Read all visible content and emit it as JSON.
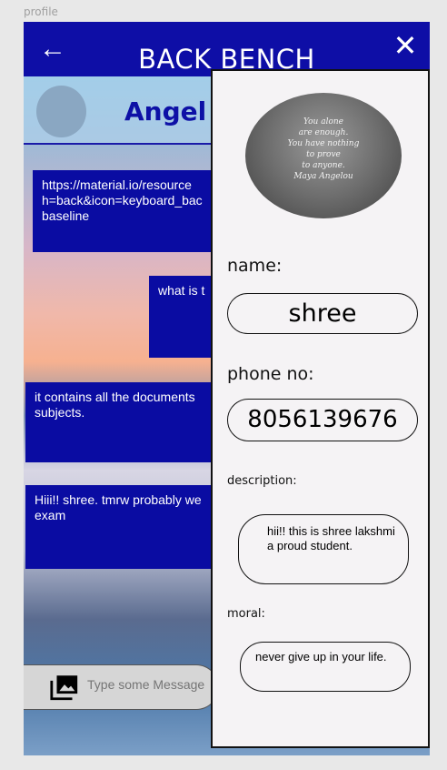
{
  "frame": {
    "label": "profile"
  },
  "appbar": {
    "title": "BACK BENCH",
    "back_icon": "arrow-left-icon",
    "close_icon": "close-icon",
    "back_glyph": "←",
    "close_glyph": "✕",
    "color": "#0e0ea6"
  },
  "chat": {
    "name": "Angel",
    "messages": [
      {
        "text": "https://material.io/resource\nh=back&icon=keyboard_bac\nbaseline"
      },
      {
        "text": "what is t"
      },
      {
        "text": "it contains all the documents\nsubjects."
      },
      {
        "text": "Hiii!! shree. tmrw probably we\nexam"
      }
    ],
    "input_placeholder": "Type some Message",
    "photo_icon": "photo-library-icon"
  },
  "profile_panel": {
    "photo_quote": "You alone\nare enough.\nYou have nothing\nto prove\nto anyone.\nMaya Angelou",
    "name_label": "name:",
    "name_value": "shree",
    "phone_label": "phone no:",
    "phone_value": "8056139676",
    "description_label": "description:",
    "description_value": "hii!! this is shree lakshmi a proud student.",
    "moral_label": "moral:",
    "moral_value": "never give up in your life."
  },
  "colors": {
    "brand_blue": "#0a0ca2",
    "panel_bg": "#f5f3f5"
  }
}
